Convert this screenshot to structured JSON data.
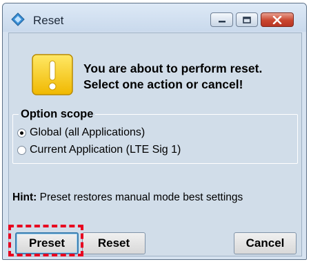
{
  "window": {
    "title": "Reset",
    "icons": {
      "app": "diamond-app-icon",
      "minimize": "minimize-icon",
      "maximize": "maximize-icon",
      "close": "close-icon"
    }
  },
  "dialog": {
    "icon": "warning-exclamation-icon",
    "message_line1": "You are about to perform reset.",
    "message_line2": "Select one action or cancel!"
  },
  "option_scope": {
    "label": "Option scope",
    "options": [
      {
        "label": "Global (all Applications)",
        "selected": true
      },
      {
        "label": "Current Application (LTE Sig 1)",
        "selected": false
      }
    ]
  },
  "hint": {
    "label": "Hint:",
    "text": "Preset restores manual mode best settings"
  },
  "buttons": {
    "preset": "Preset",
    "reset": "Reset",
    "cancel": "Cancel"
  },
  "colors": {
    "highlight": "#e8001f",
    "warning_yellow": "#f5c400",
    "close_red": "#c9462f"
  }
}
